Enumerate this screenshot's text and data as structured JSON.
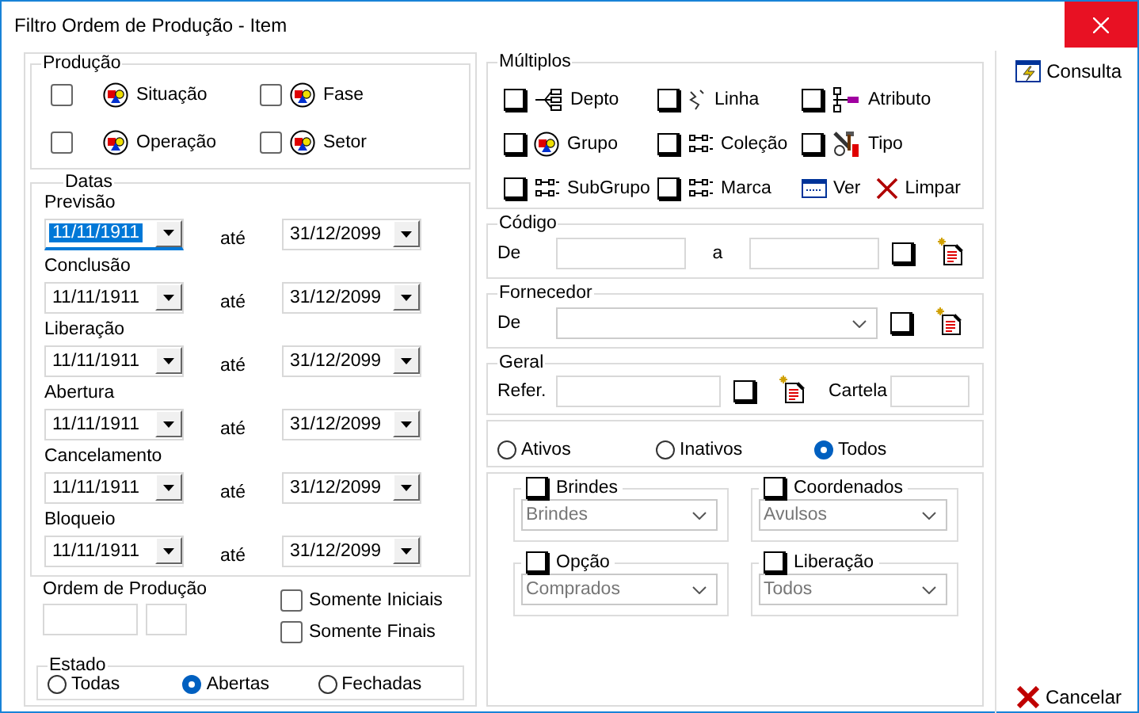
{
  "window": {
    "title": "Filtro Ordem de Produção - Item"
  },
  "producao": {
    "title": "Produção",
    "items": [
      {
        "label": "Situação",
        "checked": false
      },
      {
        "label": "Fase",
        "checked": false
      },
      {
        "label": "Operação",
        "checked": false
      },
      {
        "label": "Setor",
        "checked": false
      }
    ]
  },
  "datas": {
    "title": "Datas",
    "rows": [
      {
        "label": "Previsão",
        "from": "11/11/1911",
        "separator": "até",
        "to": "31/12/2099",
        "focused": true
      },
      {
        "label": "Conclusão",
        "from": "11/11/1911",
        "separator": "até",
        "to": "31/12/2099",
        "focused": false
      },
      {
        "label": "Liberação",
        "from": "11/11/1911",
        "separator": "até",
        "to": "31/12/2099",
        "focused": false
      },
      {
        "label": "Abertura",
        "from": "11/11/1911",
        "separator": "até",
        "to": "31/12/2099",
        "focused": false
      },
      {
        "label": "Cancelamento",
        "from": "11/11/1911",
        "separator": "até",
        "to": "31/12/2099",
        "focused": false
      },
      {
        "label": "Bloqueio",
        "from": "11/11/1911",
        "separator": "até",
        "to": "31/12/2099",
        "focused": false
      }
    ]
  },
  "ordem": {
    "label": "Ordem de Produção"
  },
  "somente": [
    {
      "label": "Somente Iniciais",
      "checked": false
    },
    {
      "label": "Somente Finais",
      "checked": false
    }
  ],
  "estado": {
    "title": "Estado",
    "options": [
      {
        "label": "Todas",
        "selected": false
      },
      {
        "label": "Abertas",
        "selected": true
      },
      {
        "label": "Fechadas",
        "selected": false
      }
    ]
  },
  "multiplos": {
    "title": "Múltiplos",
    "items": [
      {
        "label": "Depto",
        "checked": false
      },
      {
        "label": "Linha",
        "checked": false
      },
      {
        "label": "Atributo",
        "checked": false
      },
      {
        "label": "Grupo",
        "checked": false
      },
      {
        "label": "Coleção",
        "checked": false
      },
      {
        "label": "Tipo",
        "checked": false
      },
      {
        "label": "SubGrupo",
        "checked": false
      },
      {
        "label": "Marca",
        "checked": false
      }
    ],
    "actions": [
      {
        "label": "Ver"
      },
      {
        "label": "Limpar"
      }
    ]
  },
  "codigo": {
    "title": "Código",
    "from_label": "De",
    "to_label": "a",
    "checked": false
  },
  "fornecedor": {
    "title": "Fornecedor",
    "label": "De",
    "checked": false
  },
  "geral": {
    "title": "Geral",
    "label": "Refer.",
    "checked": false,
    "cartela_label": "Cartela"
  },
  "status": [
    {
      "label": "Ativos",
      "selected": false
    },
    {
      "label": "Inativos",
      "selected": false
    },
    {
      "label": "Todos",
      "selected": true
    }
  ],
  "subgroups": [
    {
      "title": "Brindes",
      "checked": false,
      "value": "Brindes"
    },
    {
      "title": "Coordenados",
      "checked": false,
      "value": "Avulsos"
    },
    {
      "title": "Opção",
      "checked": false,
      "value": "Comprados"
    },
    {
      "title": "Liberação",
      "checked": false,
      "value": "Todos"
    }
  ],
  "buttons": {
    "consulta": "Consulta",
    "cancelar": "Cancelar"
  }
}
